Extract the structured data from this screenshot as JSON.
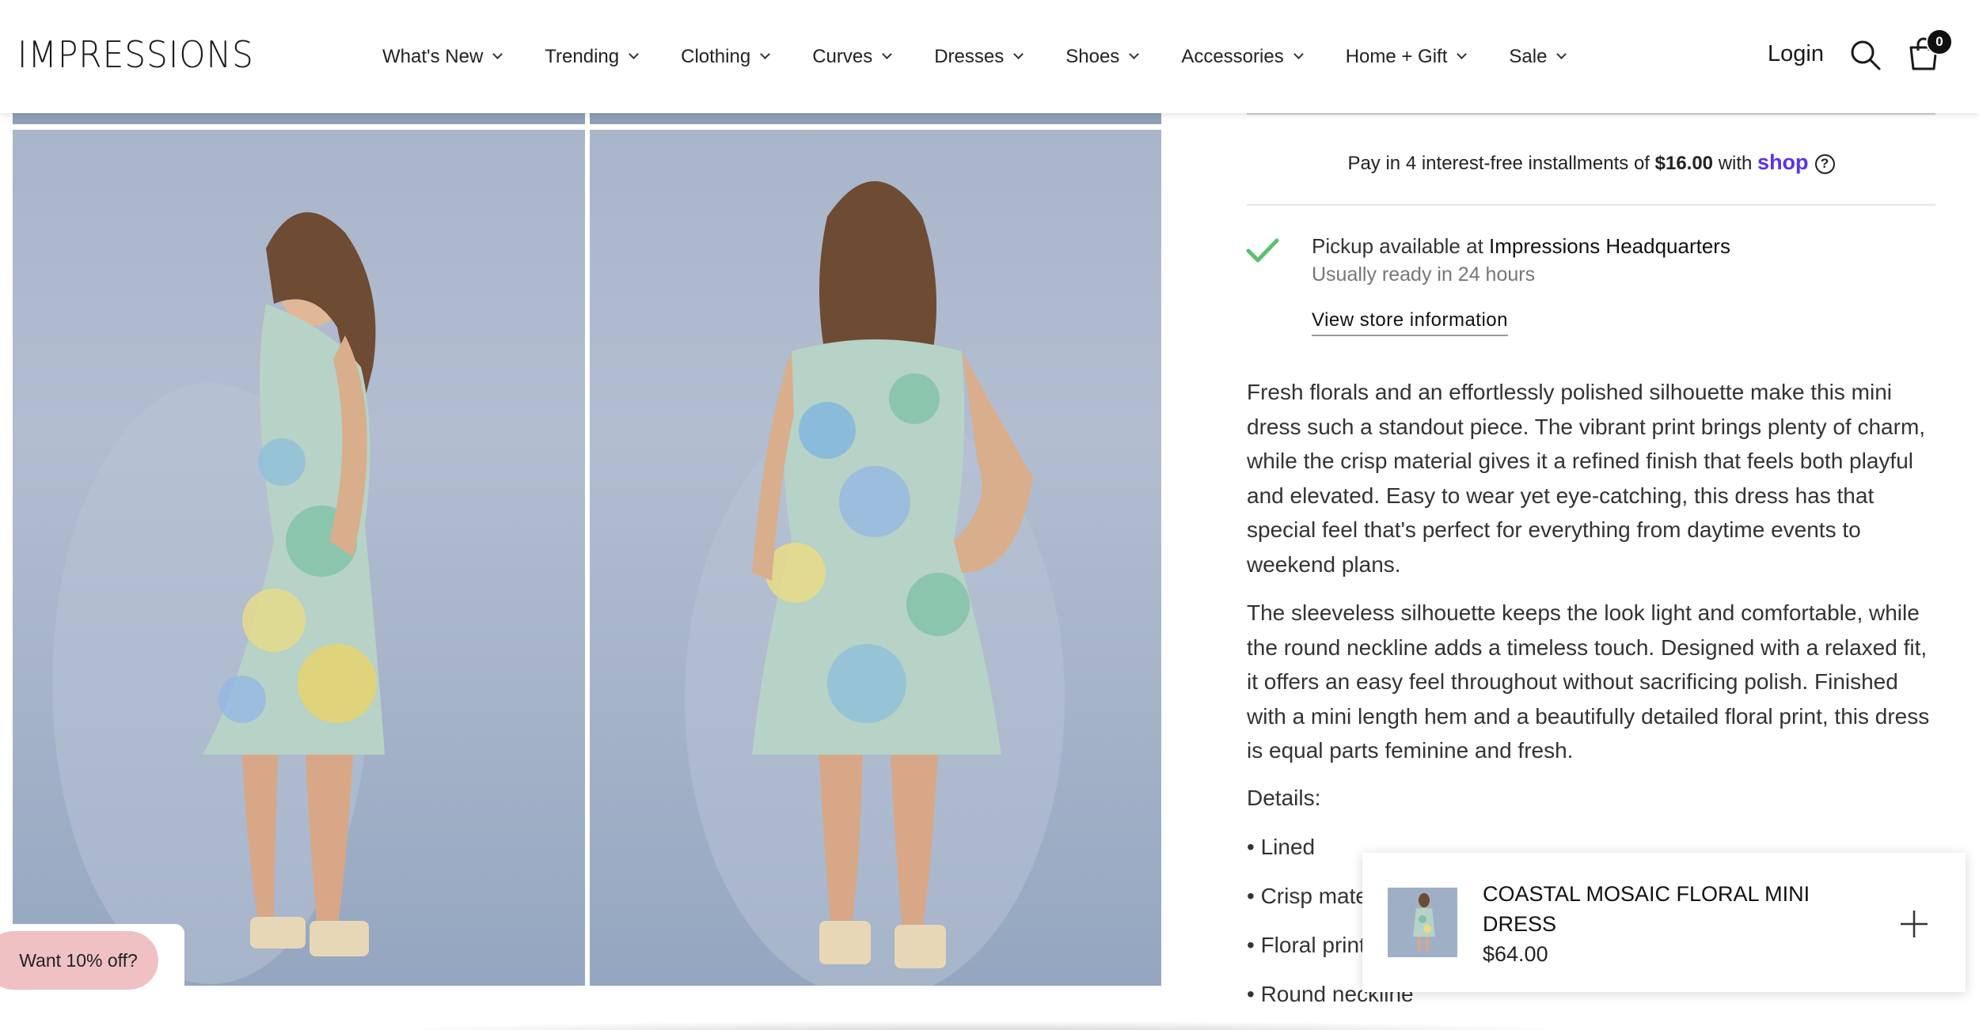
{
  "brand": {
    "logo": "IMPRESSIONS"
  },
  "nav": {
    "items": [
      {
        "label": "What's New"
      },
      {
        "label": "Trending"
      },
      {
        "label": "Clothing"
      },
      {
        "label": "Curves"
      },
      {
        "label": "Dresses"
      },
      {
        "label": "Shoes"
      },
      {
        "label": "Accessories"
      },
      {
        "label": "Home + Gift"
      },
      {
        "label": "Sale"
      }
    ],
    "login": "Login",
    "cart_count": "0",
    "icons": [
      "search-icon",
      "cart-icon",
      "chevron-down-icon"
    ]
  },
  "product": {
    "installments": {
      "prefix": "Pay in 4 interest-free installments of ",
      "amount": "$16.00",
      "middle": " with ",
      "provider": "shop",
      "help": "?"
    },
    "pickup": {
      "prefix": "Pickup available at ",
      "location": "Impressions Headquarters",
      "ready": "Usually ready in 24 hours",
      "link": "View store information"
    },
    "description": [
      "Fresh florals and an effortlessly polished silhouette make this mini dress such a standout piece. The vibrant print brings plenty of charm, while the crisp material gives it a refined finish that feels both playful and elevated. Easy to wear yet eye-catching, this dress has that special feel that's perfect for everything from daytime events to weekend plans.",
      "The sleeveless silhouette keeps the look light and comfortable, while the round neckline adds a timeless touch. Designed with a relaxed fit, it offers an easy feel throughout without sacrificing polish. Finished with a mini length hem and a beautifully detailed floral print, this dress is equal parts feminine and fresh."
    ],
    "details_label": "Details:",
    "details": [
      "• Lined",
      "• Crisp mate",
      "• Floral print",
      "• Round neckline"
    ]
  },
  "sticky_bar": {
    "title": "COASTAL MOSAIC FLORAL MINI DRESS",
    "price": "$64.00"
  },
  "promo": {
    "label": "Want 10% off?"
  },
  "colors": {
    "shop_purple": "#5a31f4",
    "check_green": "#5cc06c",
    "promo_pink": "#efc1c3"
  }
}
